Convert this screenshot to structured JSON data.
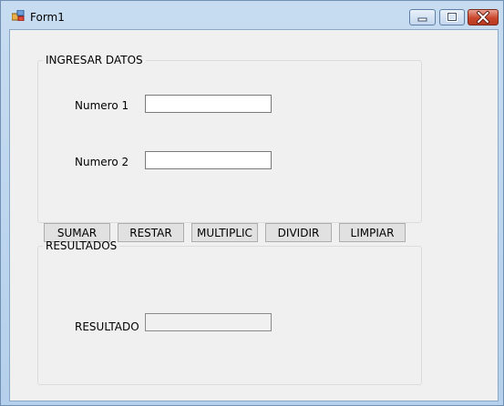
{
  "window": {
    "title": "Form1",
    "controls": {
      "minimize": "minimize",
      "maximize": "maximize",
      "close": "close"
    }
  },
  "input_group": {
    "legend": "INGRESAR DATOS",
    "numero1": {
      "label": "Numero 1",
      "value": ""
    },
    "numero2": {
      "label": "Numero 2",
      "value": ""
    },
    "buttons": {
      "sumar": "SUMAR",
      "restar": "RESTAR",
      "multiplicar": "MULTIPLIC",
      "dividir": "DIVIDIR",
      "limpiar": "LIMPIAR"
    }
  },
  "results_group": {
    "legend": "RESULTADOS",
    "resultado": {
      "label": "RESULTADO",
      "value": ""
    }
  },
  "colors": {
    "title_bar": "#c7dcf1",
    "client_background": "#f0f0f0",
    "close_button": "#c9462c"
  }
}
